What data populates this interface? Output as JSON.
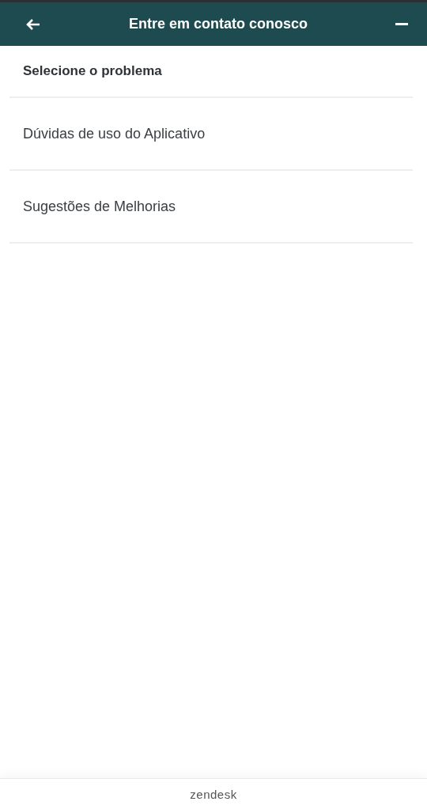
{
  "header": {
    "title": "Entre em contato conosco"
  },
  "section": {
    "heading": "Selecione o problema"
  },
  "options": [
    {
      "label": "Dúvidas de uso do Aplicativo"
    },
    {
      "label": "Sugestões de Melhorias"
    }
  ],
  "footer": {
    "brand": "zendesk"
  }
}
